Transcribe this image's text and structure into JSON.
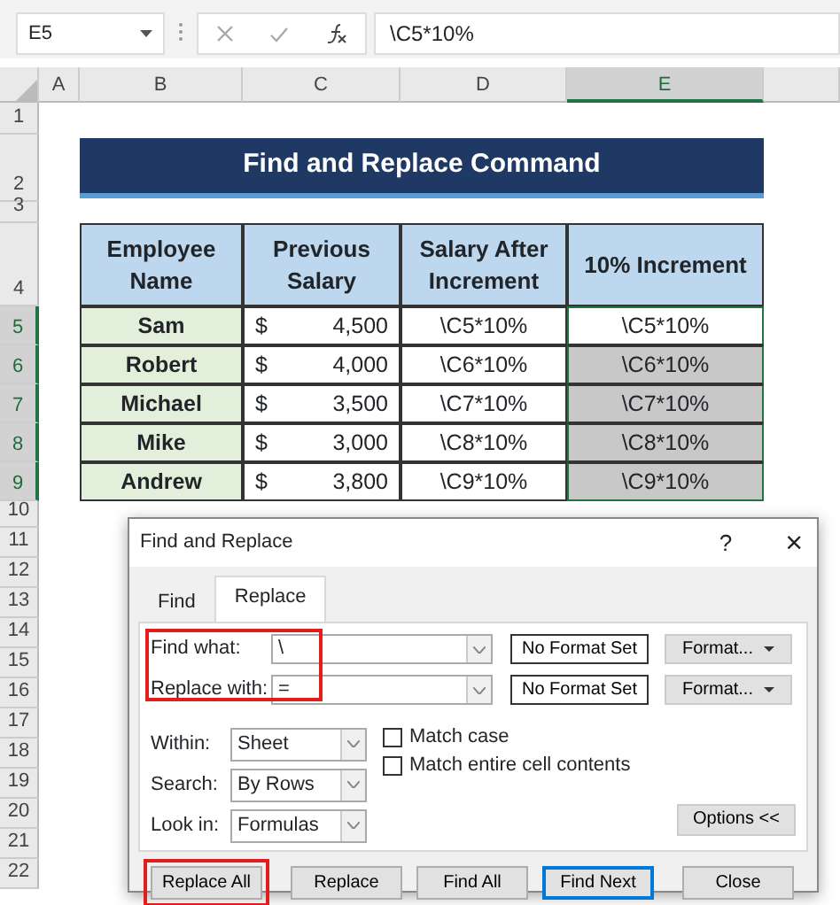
{
  "formula_bar": {
    "name_box": "E5",
    "formula": "\\C5*10%"
  },
  "columns": [
    {
      "label": "A",
      "selected": false
    },
    {
      "label": "B",
      "selected": false
    },
    {
      "label": "C",
      "selected": false
    },
    {
      "label": "D",
      "selected": false
    },
    {
      "label": "E",
      "selected": true
    }
  ],
  "row_numbers": [
    {
      "label": "1",
      "selected": false
    },
    {
      "label": "2",
      "selected": false
    },
    {
      "label": "3",
      "selected": false
    },
    {
      "label": "4",
      "selected": false
    },
    {
      "label": "5",
      "selected": true
    },
    {
      "label": "6",
      "selected": true
    },
    {
      "label": "7",
      "selected": true
    },
    {
      "label": "8",
      "selected": true
    },
    {
      "label": "9",
      "selected": true
    },
    {
      "label": "10",
      "selected": false
    },
    {
      "label": "11",
      "selected": false
    },
    {
      "label": "12",
      "selected": false
    },
    {
      "label": "13",
      "selected": false
    },
    {
      "label": "14",
      "selected": false
    },
    {
      "label": "15",
      "selected": false
    },
    {
      "label": "16",
      "selected": false
    },
    {
      "label": "17",
      "selected": false
    },
    {
      "label": "18",
      "selected": false
    },
    {
      "label": "19",
      "selected": false
    },
    {
      "label": "20",
      "selected": false
    },
    {
      "label": "21",
      "selected": false
    },
    {
      "label": "22",
      "selected": false
    }
  ],
  "title": "Find and Replace Command",
  "table": {
    "columns": [
      "Employee Name",
      "Previous Salary",
      "Salary After Increment",
      "10% Increment"
    ],
    "rows": [
      {
        "name": "Sam",
        "currency": "$",
        "previous": "4,500",
        "after": "\\C5*10%",
        "increment": "\\C5*10%",
        "highlighted": false
      },
      {
        "name": "Robert",
        "currency": "$",
        "previous": "4,000",
        "after": "\\C6*10%",
        "increment": "\\C6*10%",
        "highlighted": true
      },
      {
        "name": "Michael",
        "currency": "$",
        "previous": "3,500",
        "after": "\\C7*10%",
        "increment": "\\C7*10%",
        "highlighted": true
      },
      {
        "name": "Mike",
        "currency": "$",
        "previous": "3,000",
        "after": "\\C8*10%",
        "increment": "\\C8*10%",
        "highlighted": true
      },
      {
        "name": "Andrew",
        "currency": "$",
        "previous": "3,800",
        "after": "\\C9*10%",
        "increment": "\\C9*10%",
        "highlighted": true
      }
    ]
  },
  "dialog": {
    "title": "Find and Replace",
    "help": "?",
    "close": "×",
    "tabs": [
      {
        "label": "Find",
        "selected": false
      },
      {
        "label": "Replace",
        "selected": true
      }
    ],
    "fields": [
      {
        "label": "Find what:",
        "value": "\\",
        "format_status": "No Format Set",
        "format_button": "Format..."
      },
      {
        "label": "Replace with:",
        "value": "=",
        "format_status": "No Format Set",
        "format_button": "Format..."
      }
    ],
    "fields_highlighted": true,
    "dropdowns": [
      {
        "label": "Within:",
        "value": "Sheet"
      },
      {
        "label": "Search:",
        "value": "By Rows"
      },
      {
        "label": "Look in:",
        "value": "Formulas"
      }
    ],
    "checkboxes": [
      {
        "label": "Match case",
        "checked": false
      },
      {
        "label": "Match entire cell contents",
        "checked": false
      }
    ],
    "options_button": "Options <<",
    "buttons": [
      {
        "label": "Replace All",
        "default": false,
        "highlighted": true
      },
      {
        "label": "Replace",
        "default": false,
        "highlighted": false
      },
      {
        "label": "Find All",
        "default": false,
        "highlighted": false
      },
      {
        "label": "Find Next",
        "default": true,
        "highlighted": false
      },
      {
        "label": "Close",
        "default": false,
        "highlighted": false
      }
    ]
  }
}
